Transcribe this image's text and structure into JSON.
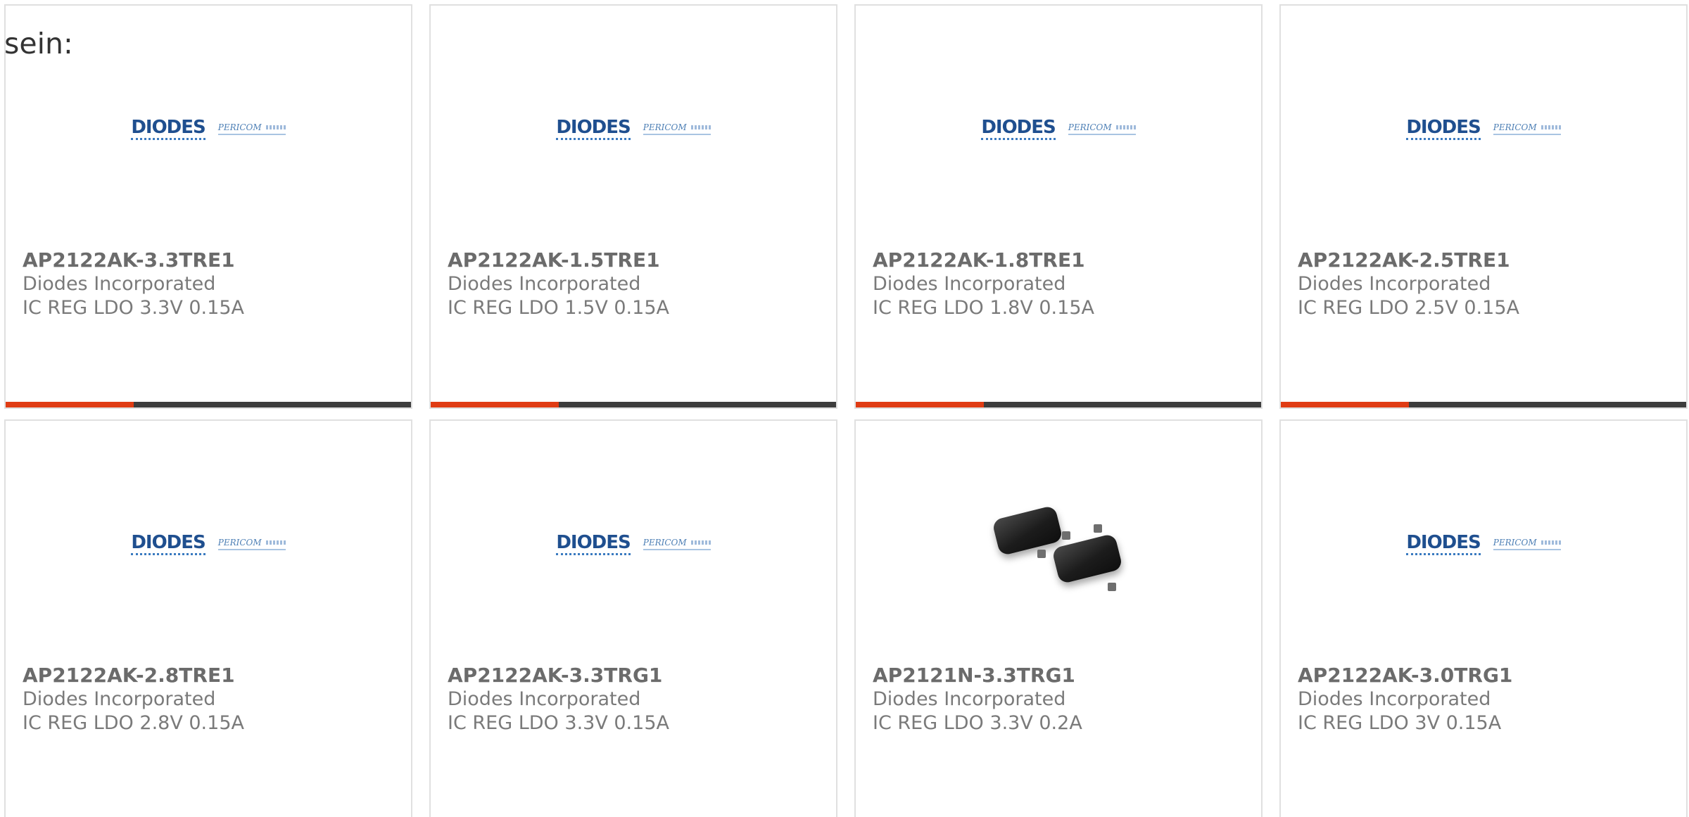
{
  "intro_text": "sein:",
  "colors": {
    "accent": "#e03c14",
    "bar": "#3d3d3d",
    "border": "#e0e0e0"
  },
  "logo": {
    "brand": "DIODES",
    "sub": "PERICOM"
  },
  "products": [
    {
      "part": "AP2122AK-3.3TRE1",
      "manufacturer": "Diodes Incorporated",
      "description": "IC REG LDO 3.3V 0.15A",
      "image": "diodes-pericom-logo"
    },
    {
      "part": "AP2122AK-1.5TRE1",
      "manufacturer": "Diodes Incorporated",
      "description": "IC REG LDO 1.5V 0.15A",
      "image": "diodes-pericom-logo"
    },
    {
      "part": "AP2122AK-1.8TRE1",
      "manufacturer": "Diodes Incorporated",
      "description": "IC REG LDO 1.8V 0.15A",
      "image": "diodes-pericom-logo"
    },
    {
      "part": "AP2122AK-2.5TRE1",
      "manufacturer": "Diodes Incorporated",
      "description": "IC REG LDO 2.5V 0.15A",
      "image": "diodes-pericom-logo"
    },
    {
      "part": "AP2122AK-2.8TRE1",
      "manufacturer": "Diodes Incorporated",
      "description": "IC REG LDO 2.8V 0.15A",
      "image": "diodes-pericom-logo"
    },
    {
      "part": "AP2122AK-3.3TRG1",
      "manufacturer": "Diodes Incorporated",
      "description": "IC REG LDO 3.3V 0.15A",
      "image": "diodes-pericom-logo"
    },
    {
      "part": "AP2121N-3.3TRG1",
      "manufacturer": "Diodes Incorporated",
      "description": "IC REG LDO 3.3V 0.2A",
      "image": "sot23-package-photo"
    },
    {
      "part": "AP2122AK-3.0TRG1",
      "manufacturer": "Diodes Incorporated",
      "description": "IC REG LDO 3V 0.15A",
      "image": "diodes-pericom-logo"
    }
  ]
}
